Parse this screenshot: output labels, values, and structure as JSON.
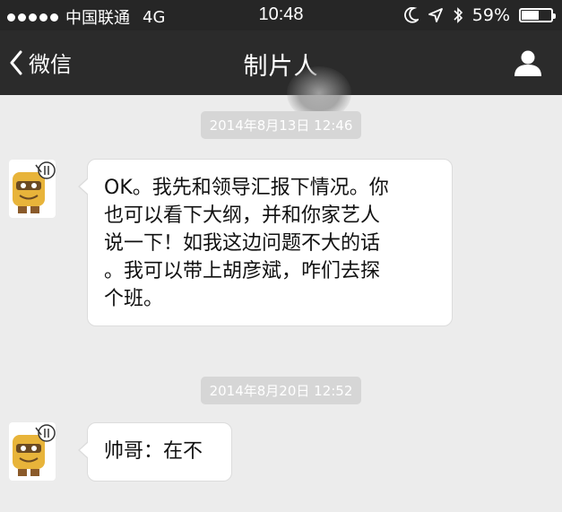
{
  "status_bar": {
    "carrier": "中国联通",
    "network": "4G",
    "time": "10:48",
    "battery_text": "59%",
    "battery_level": 0.59
  },
  "nav": {
    "back_label": "微信",
    "title": "制片人"
  },
  "messages": [
    {
      "timestamp": "2014年8月13日 12:46",
      "lines": [
        "OK。我先和领导汇报下情况。你",
        "也可以看下大纲，并和你家艺人",
        "说一下！如我这边问题不大的话",
        "。我可以带上胡彦斌，咋们去探",
        "个班。"
      ]
    },
    {
      "timestamp": "2014年8月20日 12:52",
      "lines": [
        "帅哥：在不"
      ]
    }
  ],
  "colors": {
    "status_bar_bg": "#262626",
    "nav_bg": "#2b2b2b",
    "chat_bg": "#ececec",
    "bubble_bg": "#ffffff",
    "timestamp_bg": "#d6d6d6"
  }
}
